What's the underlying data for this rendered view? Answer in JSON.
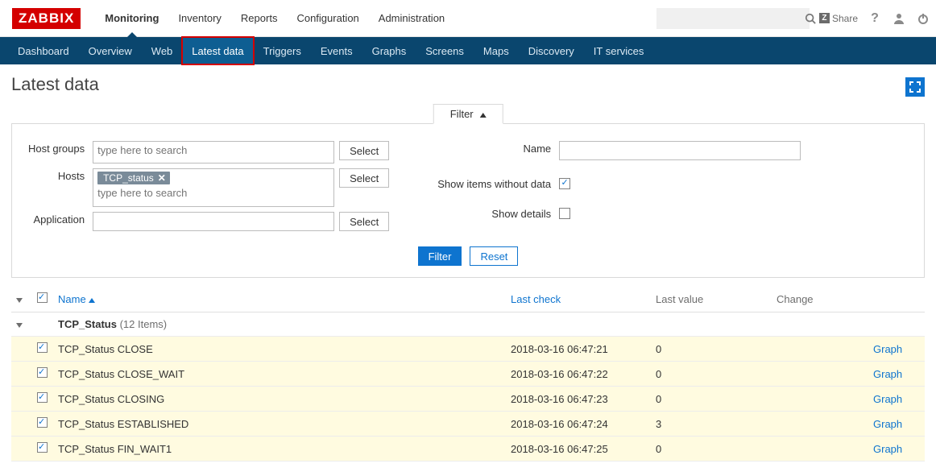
{
  "brand": "ZABBIX",
  "top_nav": {
    "items": [
      "Monitoring",
      "Inventory",
      "Reports",
      "Configuration",
      "Administration"
    ],
    "active_index": 0
  },
  "top_right": {
    "share": "Share",
    "help": "?",
    "search_placeholder": ""
  },
  "sub_nav": {
    "items": [
      "Dashboard",
      "Overview",
      "Web",
      "Latest data",
      "Triggers",
      "Events",
      "Graphs",
      "Screens",
      "Maps",
      "Discovery",
      "IT services"
    ],
    "active_index": 3
  },
  "page_title": "Latest data",
  "filter": {
    "tab_label": "Filter",
    "labels": {
      "host_groups": "Host groups",
      "hosts": "Hosts",
      "application": "Application",
      "name": "Name",
      "show_no_data": "Show items without data",
      "show_details": "Show details"
    },
    "placeholders": {
      "search": "type here to search"
    },
    "host_tag": "TCP_status",
    "show_no_data_checked": true,
    "show_details_checked": false,
    "buttons": {
      "select": "Select",
      "filter": "Filter",
      "reset": "Reset"
    }
  },
  "table": {
    "headers": {
      "name": "Name",
      "last_check": "Last check",
      "last_value": "Last value",
      "change": "Change"
    },
    "group": {
      "name": "TCP_Status",
      "count_label": "(12 Items)"
    },
    "action_label": "Graph",
    "rows": [
      {
        "name": "TCP_Status CLOSE",
        "last_check": "2018-03-16 06:47:21",
        "last_value": "0",
        "change": ""
      },
      {
        "name": "TCP_Status CLOSE_WAIT",
        "last_check": "2018-03-16 06:47:22",
        "last_value": "0",
        "change": ""
      },
      {
        "name": "TCP_Status CLOSING",
        "last_check": "2018-03-16 06:47:23",
        "last_value": "0",
        "change": ""
      },
      {
        "name": "TCP_Status ESTABLISHED",
        "last_check": "2018-03-16 06:47:24",
        "last_value": "3",
        "change": ""
      },
      {
        "name": "TCP_Status FIN_WAIT1",
        "last_check": "2018-03-16 06:47:25",
        "last_value": "0",
        "change": ""
      }
    ]
  }
}
